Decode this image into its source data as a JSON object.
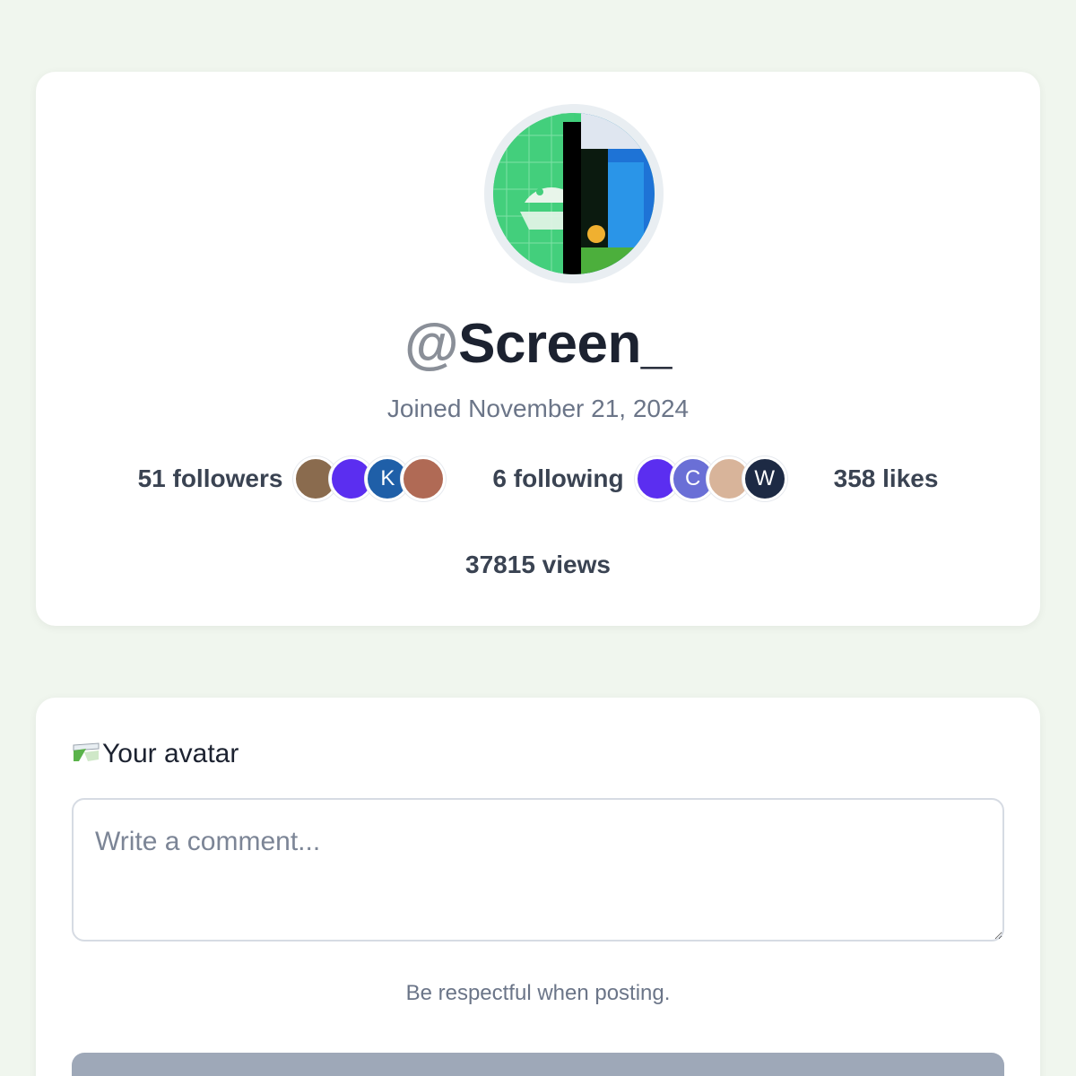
{
  "profile": {
    "at_sign": "@",
    "handle": "Screen_",
    "joined": "Joined November 21, 2024",
    "followers_label": "51 followers",
    "following_label": "6 following",
    "likes_label": "358 likes",
    "views_label": "37815 views",
    "followers_avatars": [
      {
        "name": "follower-avatar-photo-1",
        "letter": "",
        "color": "#8a6b4e"
      },
      {
        "name": "follower-avatar-sunglasses",
        "letter": "",
        "color": "#5b2ef0"
      },
      {
        "name": "follower-avatar-k",
        "letter": "K",
        "color": "#1f5fa8"
      },
      {
        "name": "follower-avatar-photo-2",
        "letter": "",
        "color": "#b06a55"
      }
    ],
    "following_avatars": [
      {
        "name": "following-avatar-sunglasses",
        "letter": "",
        "color": "#5b2ef0"
      },
      {
        "name": "following-avatar-c",
        "letter": "C",
        "color": "#6a6fd6"
      },
      {
        "name": "following-avatar-photo",
        "letter": "",
        "color": "#d8b49a"
      },
      {
        "name": "following-avatar-w",
        "letter": "W",
        "color": "#1d2a44"
      }
    ]
  },
  "comment": {
    "avatar_alt": "Your avatar",
    "placeholder": "Write a comment...",
    "hint": "Be respectful when posting."
  },
  "colors": {
    "background": "#f0f6ee",
    "card": "#ffffff",
    "muted_text": "#6b7588",
    "button_disabled": "#9ea8b8"
  }
}
